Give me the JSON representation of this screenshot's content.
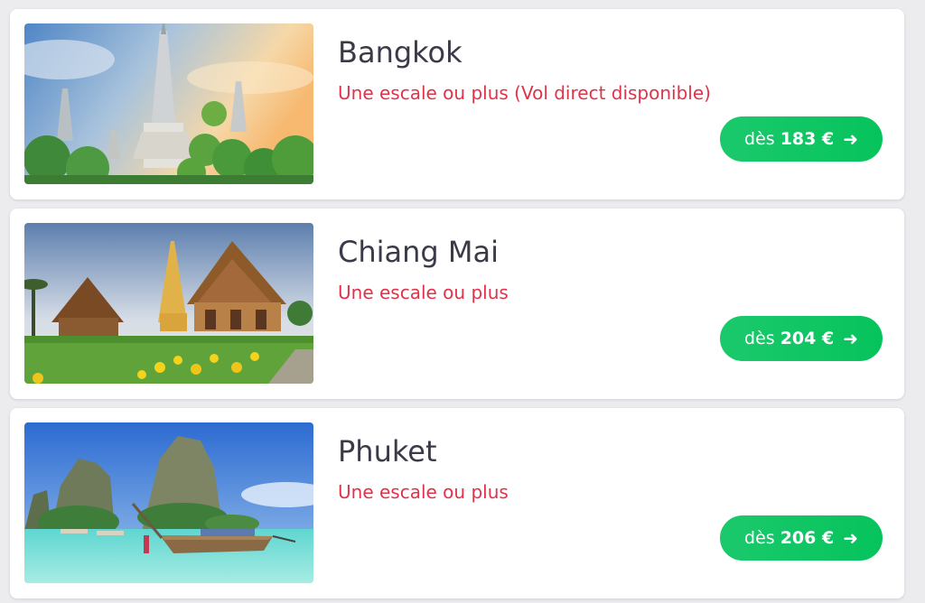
{
  "destinations": [
    {
      "city": "Bangkok",
      "stops": "Une escale ou plus (Vol direct disponible)",
      "price_prefix": "dès",
      "price": "183 €",
      "arrow": "➜",
      "image_icon": "temple-wat-arun-photo"
    },
    {
      "city": "Chiang Mai",
      "stops": "Une escale ou plus",
      "price_prefix": "dès",
      "price": "204 €",
      "arrow": "➜",
      "image_icon": "temple-chiang-mai-photo"
    },
    {
      "city": "Phuket",
      "stops": "Une escale ou plus",
      "price_prefix": "dès",
      "price": "206 €",
      "arrow": "➜",
      "image_icon": "phuket-beach-boat-photo"
    }
  ],
  "colors": {
    "stops_text": "#e0334a",
    "button_green": "#06c35c",
    "city_text": "#3a3a48"
  }
}
